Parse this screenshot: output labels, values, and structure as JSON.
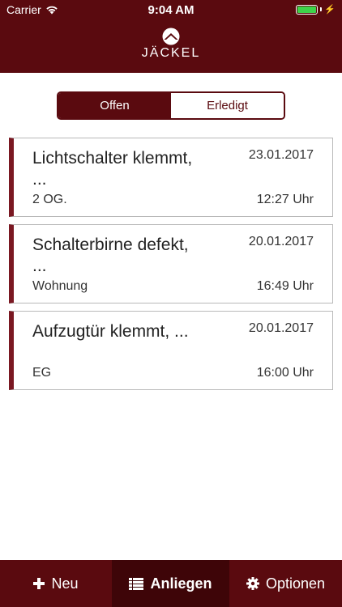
{
  "status_bar": {
    "carrier": "Carrier",
    "time": "9:04 AM"
  },
  "header": {
    "logo_text": "JÄCKEL"
  },
  "segmented": {
    "open_label": "Offen",
    "done_label": "Erledigt",
    "selected": "Offen"
  },
  "tickets": [
    {
      "title": "Lichtschalter klemmt, ...",
      "date": "23.01.2017",
      "location": "2 OG.",
      "time": "12:27 Uhr"
    },
    {
      "title": "Schalterbirne defekt, ...",
      "date": "20.01.2017",
      "location": "Wohnung",
      "time": "16:49 Uhr"
    },
    {
      "title": "Aufzugtür klemmt, ...",
      "date": "20.01.2017",
      "location": "EG",
      "time": "16:00 Uhr"
    }
  ],
  "tabbar": {
    "new_label": "Neu",
    "requests_label": "Anliegen",
    "options_label": "Optionen",
    "active": "Anliegen"
  },
  "colors": {
    "brand": "#5a0a0f",
    "active_tab": "#3e0508",
    "accent_stripe": "#7a1822",
    "battery": "#3ed34a"
  },
  "icons": {
    "new": "plus-icon",
    "requests": "list-icon",
    "options": "gear-icon"
  }
}
